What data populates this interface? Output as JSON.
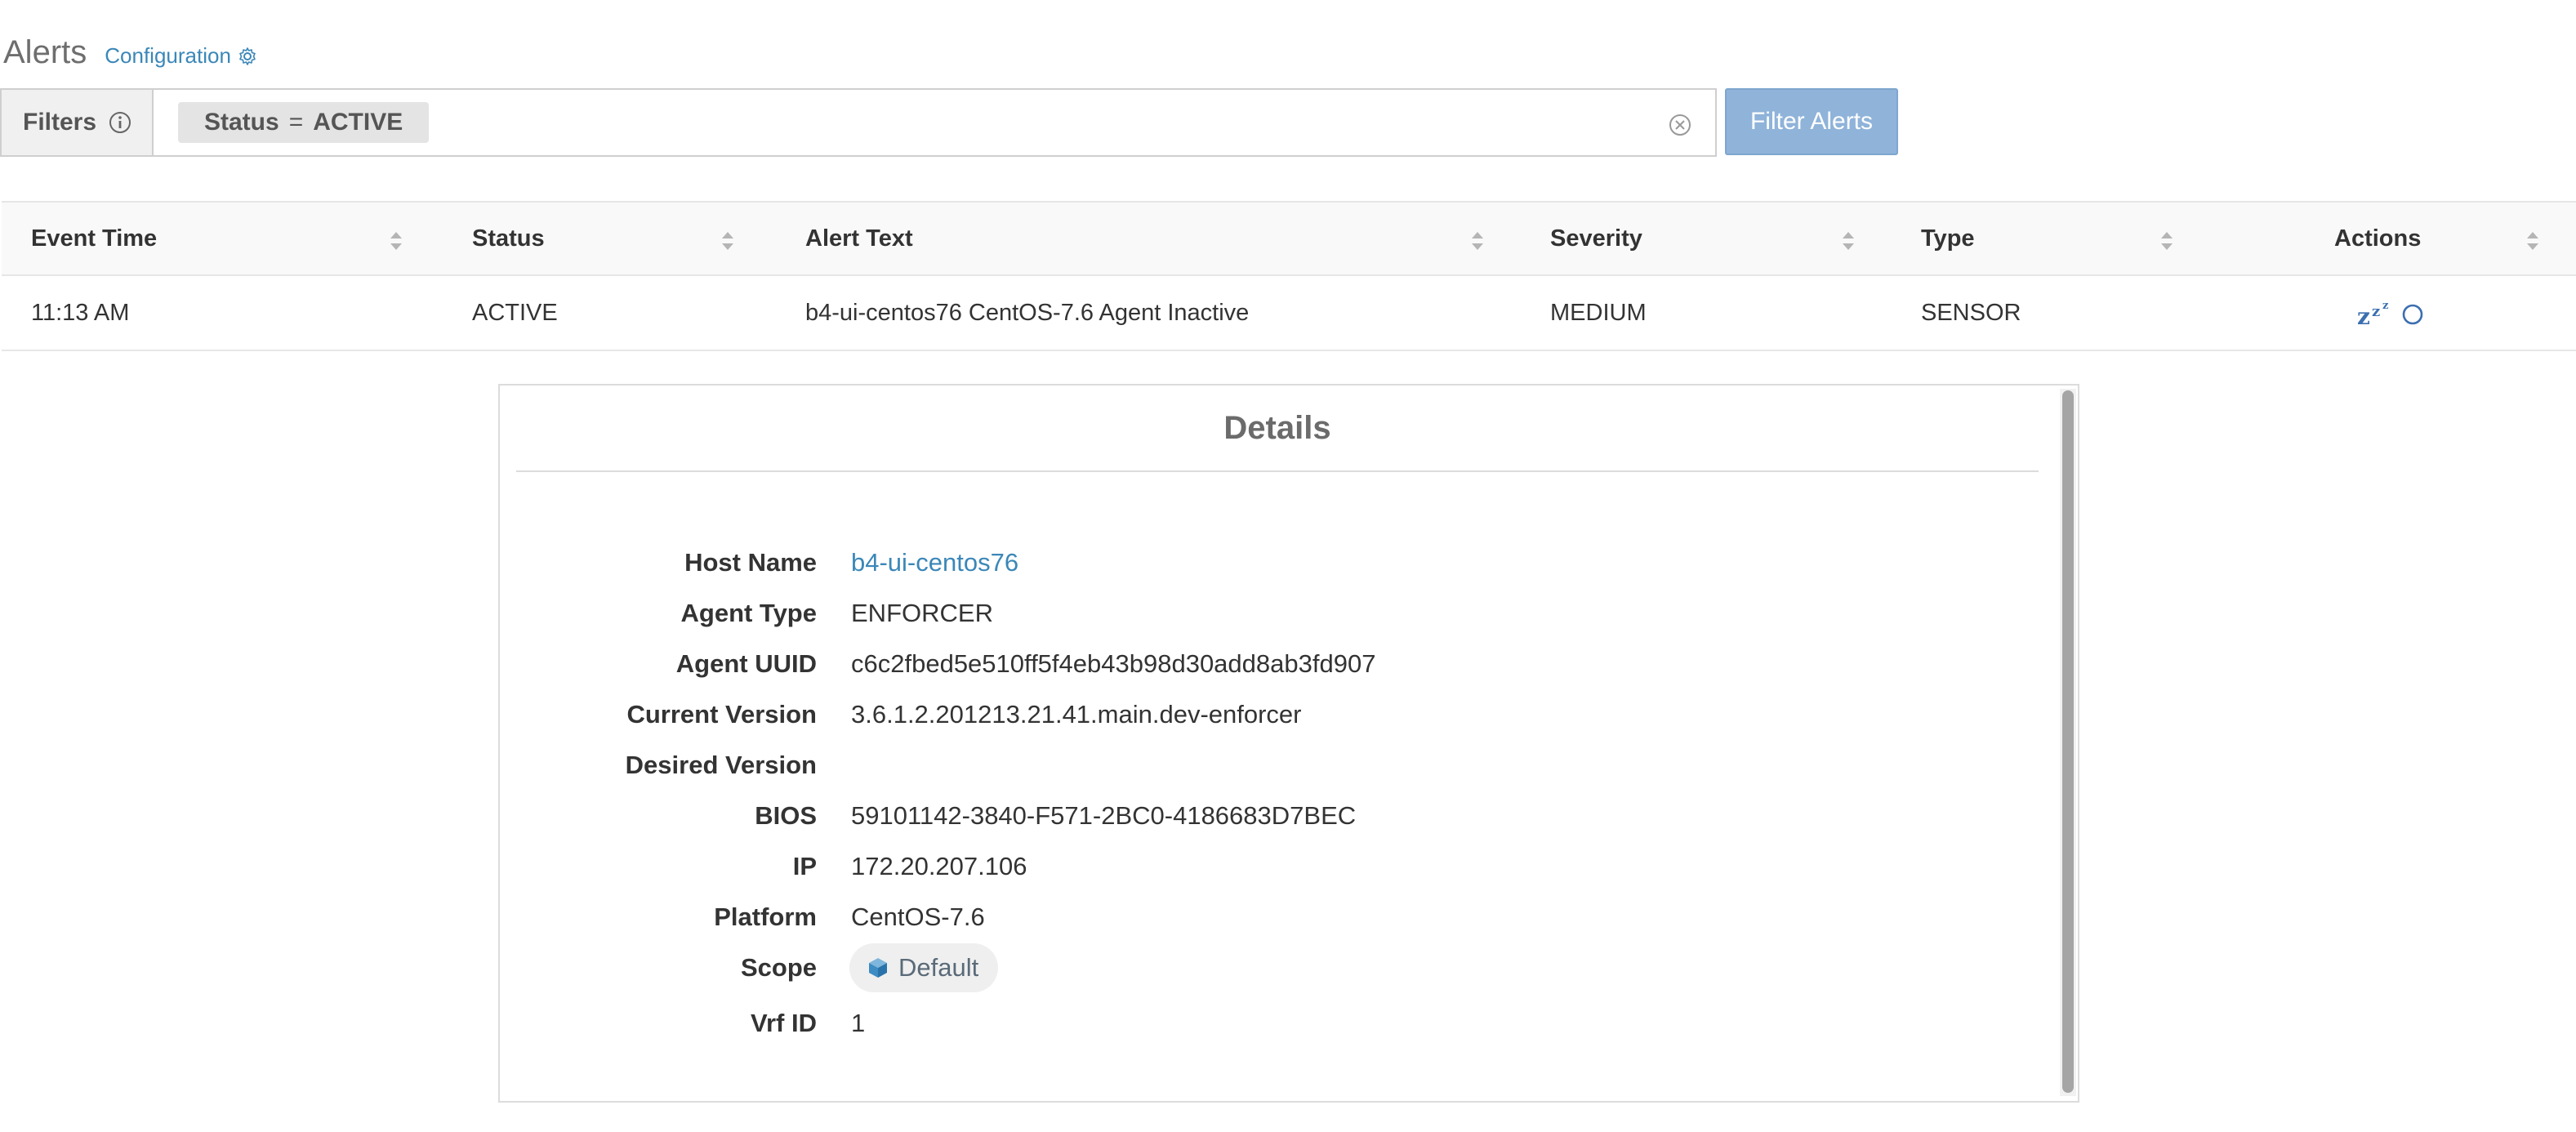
{
  "header": {
    "title": "Alerts",
    "config_link": "Configuration"
  },
  "filters": {
    "label": "Filters",
    "chip": {
      "field": "Status",
      "operator": "=",
      "value": "ACTIVE"
    },
    "button_label": "Filter Alerts"
  },
  "table": {
    "columns": [
      "Event Time",
      "Status",
      "Alert Text",
      "Severity",
      "Type",
      "Actions"
    ],
    "rows": [
      {
        "event_time": "11:13 AM",
        "status": "ACTIVE",
        "alert_text": "b4-ui-centos76 CentOS-7.6 Agent Inactive",
        "severity": "MEDIUM",
        "type": "SENSOR",
        "actions": {
          "snooze": "zzz",
          "snooze_icon": "snooze-icon",
          "clear_icon": "circle-icon"
        }
      }
    ]
  },
  "details": {
    "title": "Details",
    "fields": [
      {
        "label": "Host Name",
        "value": "b4-ui-centos76"
      },
      {
        "label": "Agent Type",
        "value": "ENFORCER"
      },
      {
        "label": "Agent UUID",
        "value": "c6c2fbed5e510ff5f4eb43b98d30add8ab3fd907"
      },
      {
        "label": "Current Version",
        "value": "3.6.1.2.201213.21.41.main.dev-enforcer"
      },
      {
        "label": "Desired Version",
        "value": ""
      },
      {
        "label": "BIOS",
        "value": "59101142-3840-F571-2BC0-4186683D7BEC"
      },
      {
        "label": "IP",
        "value": "172.20.207.106"
      },
      {
        "label": "Platform",
        "value": "CentOS-7.6"
      },
      {
        "label": "Scope",
        "value": "Default"
      },
      {
        "label": "Vrf ID",
        "value": "1"
      }
    ]
  },
  "colors": {
    "link": "#3b87b8",
    "button": "#8fb3d9",
    "border": "#cfcfcf"
  }
}
